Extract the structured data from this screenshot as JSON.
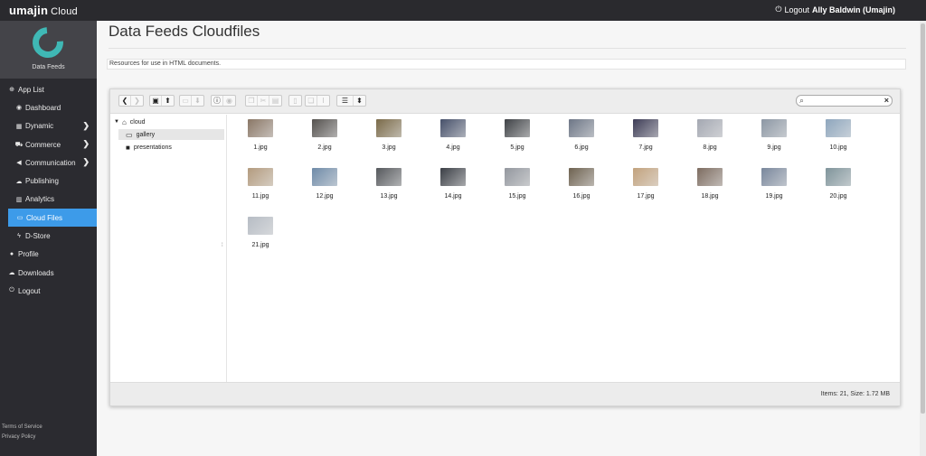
{
  "brand": {
    "name": "umajin",
    "sub": "Cloud"
  },
  "topbar": {
    "logout_label": "Logout",
    "user": "Ally Baldwin (Umajin)"
  },
  "sidebar": {
    "logo_label": "Data Feeds",
    "items": [
      {
        "label": "App List",
        "icon": "plus-circle-icon",
        "glyph": "⊕",
        "level": "top"
      },
      {
        "label": "Dashboard",
        "icon": "dashboard-icon",
        "glyph": "◉",
        "level": "sub"
      },
      {
        "label": "Dynamic",
        "icon": "table-icon",
        "glyph": "▦",
        "level": "sub",
        "chevron": "❯"
      },
      {
        "label": "Commerce",
        "icon": "truck-icon",
        "glyph": "⛟",
        "level": "sub",
        "chevron": "❯"
      },
      {
        "label": "Communication",
        "icon": "megaphone-icon",
        "glyph": "◀",
        "level": "sub",
        "chevron": "❯"
      },
      {
        "label": "Publishing",
        "icon": "cloud-upload-icon",
        "glyph": "☁",
        "level": "sub"
      },
      {
        "label": "Analytics",
        "icon": "chart-icon",
        "glyph": "▥",
        "level": "sub"
      },
      {
        "label": "Cloud Files",
        "icon": "folder-open-icon",
        "glyph": "▭",
        "level": "sub",
        "active": true
      },
      {
        "label": "D-Store",
        "icon": "bolt-icon",
        "glyph": "ϟ",
        "level": "sub"
      },
      {
        "label": "Profile",
        "icon": "user-icon",
        "glyph": "●",
        "level": "top"
      },
      {
        "label": "Downloads",
        "icon": "cloud-download-icon",
        "glyph": "☁",
        "level": "top"
      },
      {
        "label": "Logout",
        "icon": "power-icon",
        "glyph": "⏻",
        "level": "top"
      }
    ],
    "footer": {
      "terms": "Terms of Service",
      "privacy": "Privacy Policy"
    }
  },
  "main": {
    "title": "Data Feeds Cloudfiles",
    "description": "Resources for use in HTML documents."
  },
  "file_manager": {
    "search_placeholder": "",
    "tree": {
      "root": "cloud",
      "folders": [
        {
          "label": "gallery",
          "selected": true
        },
        {
          "label": "presentations",
          "selected": false
        }
      ]
    },
    "files": [
      {
        "name": "1.jpg",
        "color": "#8a7766"
      },
      {
        "name": "2.jpg",
        "color": "#54514e"
      },
      {
        "name": "3.jpg",
        "color": "#7a6a48"
      },
      {
        "name": "4.jpg",
        "color": "#46506a"
      },
      {
        "name": "5.jpg",
        "color": "#3f4246"
      },
      {
        "name": "6.jpg",
        "color": "#6d7686"
      },
      {
        "name": "7.jpg",
        "color": "#3d3c56"
      },
      {
        "name": "8.jpg",
        "color": "#a4a8b2"
      },
      {
        "name": "9.jpg",
        "color": "#8c97a4"
      },
      {
        "name": "10.jpg",
        "color": "#8ea6bd"
      },
      {
        "name": "11.jpg",
        "color": "#b39b7e"
      },
      {
        "name": "12.jpg",
        "color": "#6f8ba8"
      },
      {
        "name": "13.jpg",
        "color": "#55585c"
      },
      {
        "name": "14.jpg",
        "color": "#3a3e45"
      },
      {
        "name": "15.jpg",
        "color": "#93979e"
      },
      {
        "name": "16.jpg",
        "color": "#6e6250"
      },
      {
        "name": "17.jpg",
        "color": "#c2a27d"
      },
      {
        "name": "18.jpg",
        "color": "#7d6c60"
      },
      {
        "name": "19.jpg",
        "color": "#79879c"
      },
      {
        "name": "20.jpg",
        "color": "#7f949b"
      },
      {
        "name": "21.jpg",
        "color": "#b6bcc4"
      }
    ],
    "status": "Items: 21, Size: 1.72 MB"
  }
}
